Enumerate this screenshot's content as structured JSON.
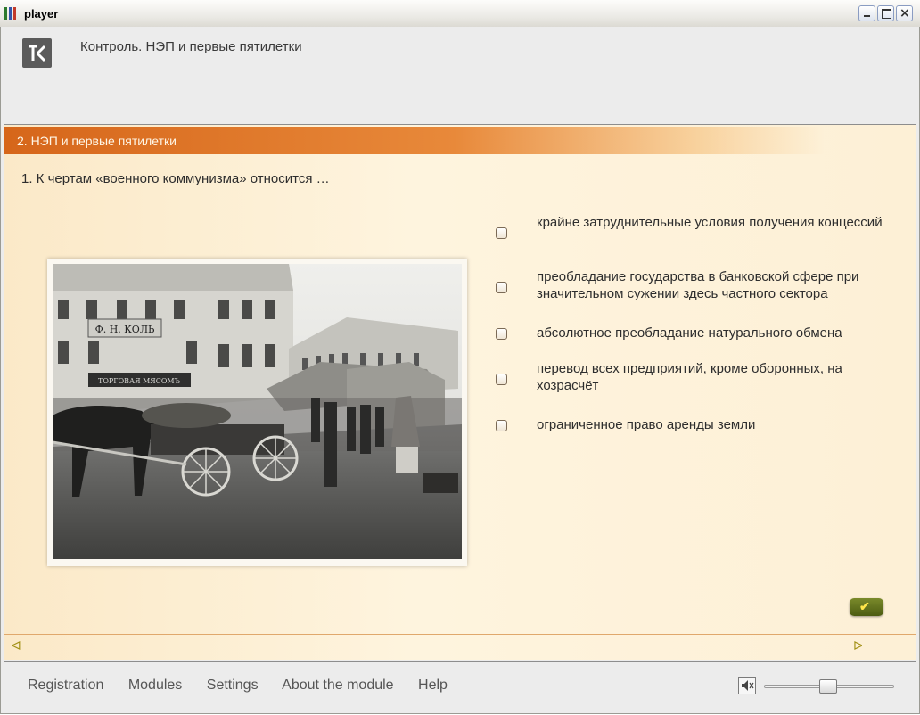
{
  "window": {
    "title": "player"
  },
  "header": {
    "course_title": "Контроль. НЭП и первые пятилетки"
  },
  "section": {
    "title": "2. НЭП и первые пятилетки"
  },
  "question": {
    "text": "1. К чертам «военного коммунизма» относится …",
    "answers": [
      {
        "text": "крайне затруднительные условия получения концессий",
        "checked": false
      },
      {
        "text": "преобладание государства в банковской сфере при значительном сужении здесь частного сектора",
        "checked": false
      },
      {
        "text": "абсолютное преобладание натурального обмена",
        "checked": false
      },
      {
        "text": "перевод всех предприятий, кроме оборонных, на хозрасчёт",
        "checked": false
      },
      {
        "text": "ограниченное право аренды земли",
        "checked": false
      }
    ]
  },
  "photo": {
    "signs": [
      "Ф. Н. КОЛЬ",
      "ТОРГОВАЯ МЯСОМЪ"
    ]
  },
  "controls": {
    "check_label": "✔",
    "prev_label": "ᐊ",
    "next_label": "ᐅ"
  },
  "footer": {
    "menu": [
      "Registration",
      "Modules",
      "Settings",
      "About the module",
      "Help"
    ],
    "volume": 0.5
  },
  "colors": {
    "accent": "#d6661a",
    "background": "#fdf0d6",
    "check_button": "#5d6d1c"
  }
}
